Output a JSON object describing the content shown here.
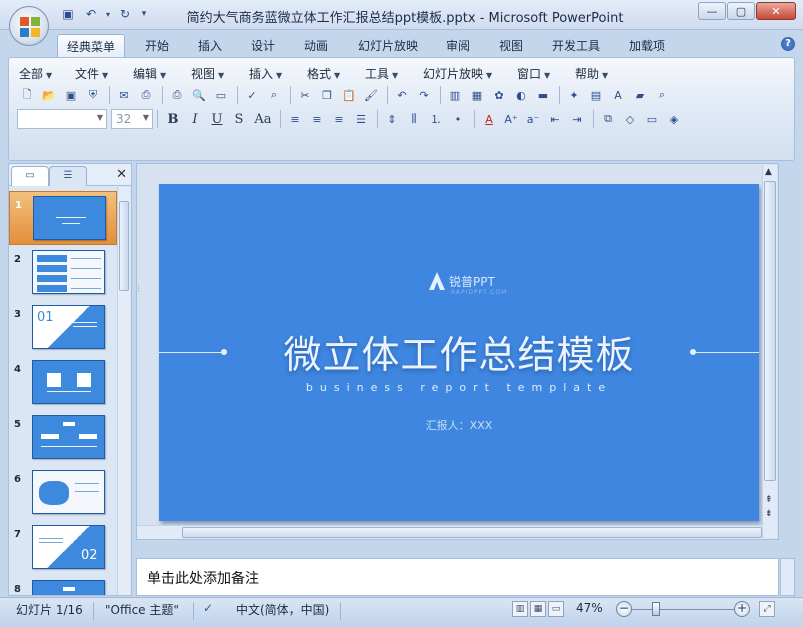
{
  "window": {
    "title": "简约大气商务蓝微立体工作汇报总结ppt模板.pptx - Microsoft PowerPoint"
  },
  "icons": {
    "office_button": "office-logo-icon",
    "save": "save-icon",
    "undo": "undo-icon",
    "redo": "redo-icon",
    "qat_customize": "chevron-down-icon",
    "minimize": "minimize-icon",
    "maximize": "maximize-icon",
    "close": "close-icon",
    "help": "help-icon"
  },
  "ribbon_tabs": [
    "经典菜单",
    "开始",
    "插入",
    "设计",
    "动画",
    "幻灯片放映",
    "审阅",
    "视图",
    "开发工具",
    "加载项"
  ],
  "active_tab": "经典菜单",
  "classic_menus": [
    "全部",
    "文件",
    "编辑",
    "视图",
    "插入",
    "格式",
    "工具",
    "幻灯片放映",
    "窗口",
    "帮助"
  ],
  "format_toolbar": {
    "font_name": "",
    "font_size": "32",
    "bold": "B",
    "italic": "I",
    "underline": "U",
    "shadow": "S",
    "change_case": "Aa"
  },
  "panel_tabs": {
    "slides_tab_icon": "slides-tab-icon",
    "outline_tab_icon": "outline-tab-icon",
    "close_icon": "close-icon"
  },
  "slides": [
    {
      "number": "1",
      "selected": true
    },
    {
      "number": "2",
      "selected": false
    },
    {
      "number": "3",
      "selected": false,
      "label": "01"
    },
    {
      "number": "4",
      "selected": false
    },
    {
      "number": "5",
      "selected": false
    },
    {
      "number": "6",
      "selected": false
    },
    {
      "number": "7",
      "selected": false,
      "label": "02"
    },
    {
      "number": "8",
      "selected": false
    }
  ],
  "current_slide": {
    "brand": "锐普PPT",
    "brand_sub": "RAPIDPPT.COM",
    "title": "微立体工作总结模板",
    "subtitle": "business report template",
    "reporter": "汇报人：XXX",
    "background": "#3e86df"
  },
  "notes": {
    "placeholder": "单击此处添加备注"
  },
  "status": {
    "slide_info": "幻灯片 1/16",
    "theme": "\"Office 主题\"",
    "language": "中文(简体，中国)",
    "zoom": "47%",
    "zoom_level_fraction": 0.47
  },
  "colors": {
    "accent": "#3e86df",
    "selected_thumb": "#e28f3b",
    "chrome": "#c4d6ec"
  }
}
